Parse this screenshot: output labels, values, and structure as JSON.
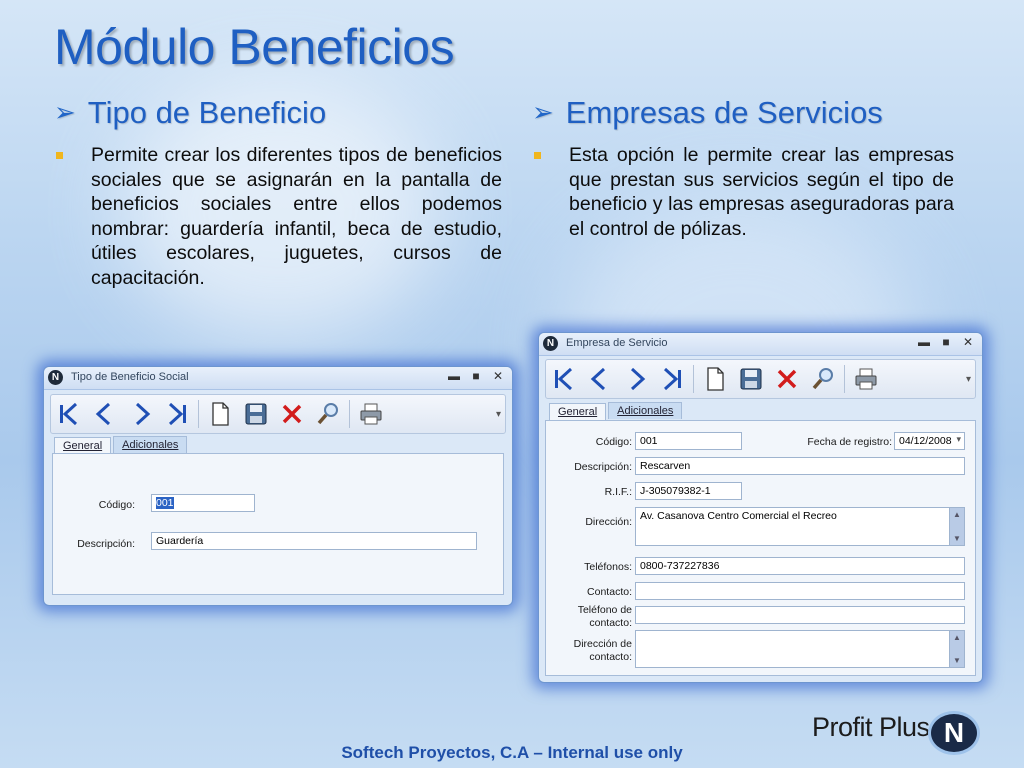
{
  "slide": {
    "title": "Módulo Beneficios",
    "left_heading": "Tipo de Beneficio",
    "left_text": "Permite crear los diferentes tipos de beneficios sociales que se asignarán en la pantalla de beneficios sociales entre ellos podemos nombrar: guardería infantil, beca de estudio, útiles escolares, juguetes, cursos de capacitación.",
    "right_heading": "Empresas de Servicios",
    "right_text": "Esta opción le permite crear las empresas que prestan sus servicios según el tipo de beneficio y las empresas aseguradoras para el control de pólizas.",
    "bullet_glyph": "➢",
    "footer": "Softech Proyectos, C.A – Internal use only",
    "brand": "Profit Plus",
    "brand_logo_letter": "N"
  },
  "colors": {
    "title": "#1f5fc2",
    "bullet_square": "#f0b61e",
    "window_glow": "#1e50c8",
    "selection": "#2b63c4"
  },
  "window_common": {
    "logo_letter": "N",
    "minimize": "▬",
    "maximize": "■",
    "close": "✕",
    "toolbar_icons": [
      "first-record-icon",
      "prev-record-icon",
      "next-record-icon",
      "last-record-icon",
      "new-document-icon",
      "save-icon",
      "delete-icon",
      "search-icon",
      "print-icon"
    ],
    "dropdown_glyph": "▾"
  },
  "window1": {
    "title": "Tipo de Beneficio Social",
    "tabs": [
      "General",
      "Adicionales"
    ],
    "codigo_label": "Código:",
    "codigo_value": "001",
    "descripcion_label": "Descripción:",
    "descripcion_value": "Guardería"
  },
  "window2": {
    "title": "Empresa de Servicio",
    "tabs": [
      "General",
      "Adicionales"
    ],
    "codigo_label": "Código:",
    "codigo_value": "001",
    "fecha_label": "Fecha de registro:",
    "fecha_value": "04/12/2008",
    "descripcion_label": "Descripción:",
    "descripcion_value": "Rescarven",
    "rif_label": "R.I.F.:",
    "rif_value": "J-305079382-1",
    "direccion_label": "Dirección:",
    "direccion_value": "Av. Casanova Centro Comercial el Recreo",
    "telefonos_label": "Teléfonos:",
    "telefonos_value": "0800-737227836",
    "contacto_label": "Contacto:",
    "contacto_value": "",
    "telefono_contacto_label_1": "Teléfono de",
    "telefono_contacto_label_2": "contacto:",
    "telefono_contacto_value": "",
    "direccion_contacto_label_1": "Dirección de",
    "direccion_contacto_label_2": "contacto:",
    "direccion_contacto_value": ""
  }
}
